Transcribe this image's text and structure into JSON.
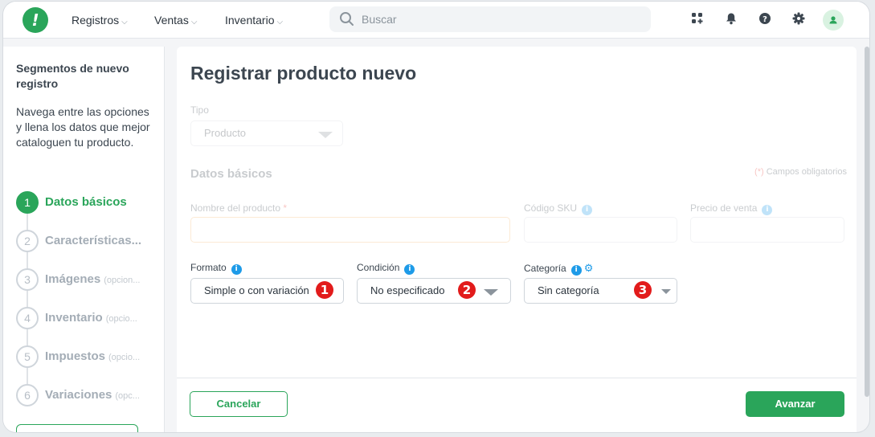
{
  "nav": {
    "items": [
      {
        "label": "Registros",
        "caret": "⌵"
      },
      {
        "label": "Ventas",
        "caret": "⌵"
      },
      {
        "label": "Inventario",
        "caret": "⌵"
      }
    ],
    "search_placeholder": "Buscar",
    "icons": [
      "apps-icon",
      "bell-icon",
      "help-icon",
      "gear-icon",
      "avatar-icon"
    ]
  },
  "sidebar": {
    "title": "Segmentos de nuevo registro",
    "description": "Navega entre las opciones y llena los datos que mejor cataloguen tu producto.",
    "steps": [
      {
        "num": "1",
        "label": "Datos básicos",
        "optional": ""
      },
      {
        "num": "2",
        "label": "Características...",
        "optional": ""
      },
      {
        "num": "3",
        "label": "Imágenes",
        "optional": "(opcion..."
      },
      {
        "num": "4",
        "label": "Inventario",
        "optional": "(opcio..."
      },
      {
        "num": "5",
        "label": "Impuestos",
        "optional": "(opcio..."
      },
      {
        "num": "6",
        "label": "Variaciones",
        "optional": "(opc..."
      }
    ]
  },
  "main": {
    "title": "Registrar producto nuevo",
    "tipo_label": "Tipo",
    "tipo_value": "Producto",
    "section_title": "Datos básicos",
    "required_note": "Campos obligatorios",
    "required_mark": "(*)",
    "fields": {
      "nombre_label": "Nombre del producto",
      "sku_label": "Código SKU",
      "precio_label": "Precio de venta",
      "formato_label": "Formato",
      "formato_value": "Simple o con variación",
      "condicion_label": "Condición",
      "condicion_value": "No especificado",
      "categoria_label": "Categoría",
      "categoria_value": "Sin categoría"
    },
    "badges": [
      "1",
      "2",
      "3"
    ],
    "buttons": {
      "cancel": "Cancelar",
      "next": "Avanzar"
    }
  },
  "colors": {
    "accent": "#2aa55a",
    "info": "#1e9be8",
    "badge": "#e21b1b"
  }
}
